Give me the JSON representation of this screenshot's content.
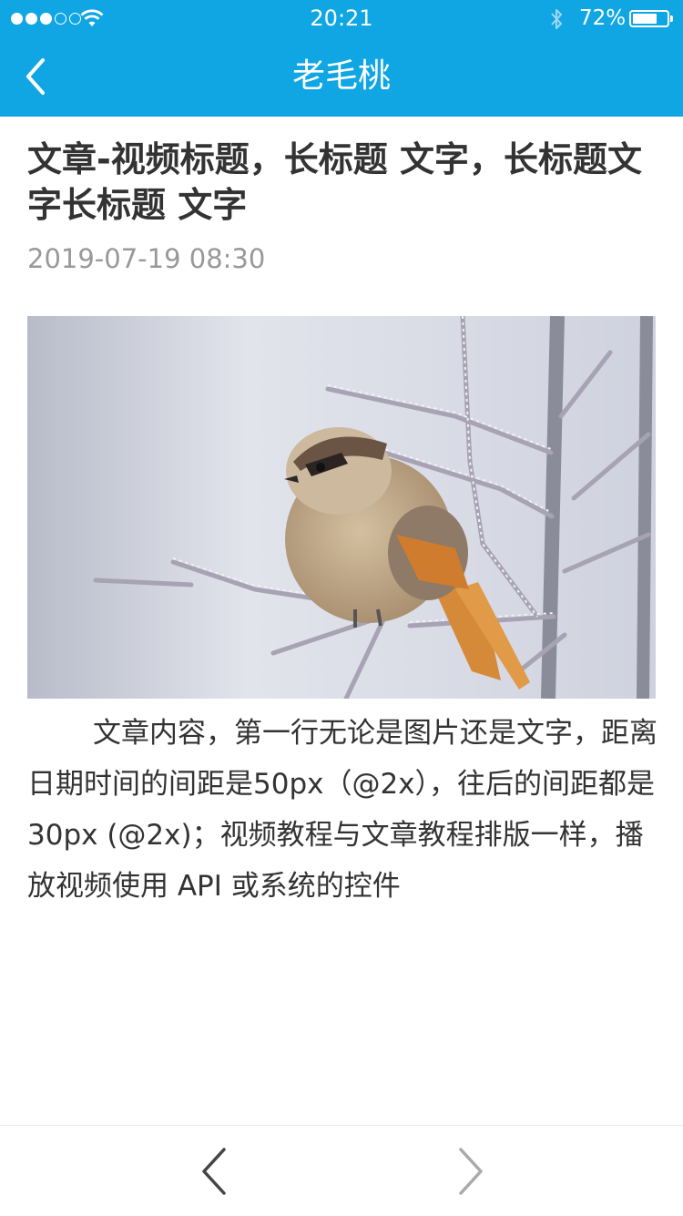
{
  "status_bar": {
    "time": "20:21",
    "battery_percent": "72%",
    "battery_level": 0.72,
    "signal_bars_filled": 3,
    "signal_bars_total": 5
  },
  "nav": {
    "title": "老毛桃",
    "back_icon": "chevron-left-icon"
  },
  "article": {
    "title": "文章-视频标题，长标题 文字，长标题文字长标题 文字",
    "date": "2019-07-19 08:30",
    "image": "bird-on-frosted-branch",
    "body": "文章内容，第一行无论是图片还是文字，距离日期时间的间距是50px（@2x），往后的间距都是30px (@2x)；视频教程与文章教程排版一样，播放视频使用 API 或系统的控件"
  },
  "bottom_bar": {
    "prev_icon": "chevron-left-icon",
    "next_icon": "chevron-right-icon",
    "prev_enabled": true,
    "next_enabled": false
  },
  "colors": {
    "header": "#0fa6e3",
    "title_text": "#333333",
    "date_text": "#999999",
    "disabled_icon": "#aaaaaa",
    "enabled_icon": "#444444"
  }
}
